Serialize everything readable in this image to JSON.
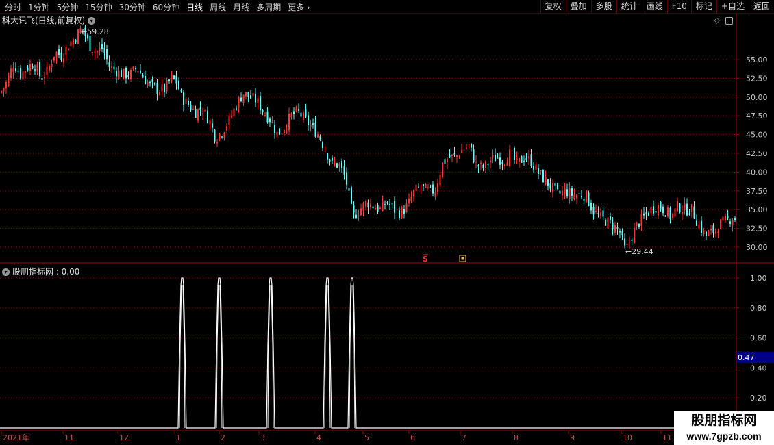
{
  "toolbar": {
    "periods": [
      "分时",
      "1分钟",
      "5分钟",
      "15分钟",
      "30分钟",
      "60分钟",
      "日线",
      "周线",
      "月线",
      "多周期",
      "更多"
    ],
    "active_index": 6,
    "right_buttons": [
      "复权",
      "叠加",
      "多股",
      "统计",
      "画线",
      "F10",
      "标记",
      "+自选",
      "返回"
    ]
  },
  "main_chart": {
    "title": "科大讯飞(日线,前复权)",
    "high_label": "59.28",
    "low_label": "29.44",
    "y_ticks": [
      "55.00",
      "52.50",
      "50.00",
      "47.50",
      "45.00",
      "42.50",
      "40.00",
      "37.50",
      "35.00",
      "32.50",
      "30.00"
    ],
    "y_values": [
      55,
      52.5,
      50,
      47.5,
      45,
      42.5,
      40,
      37.5,
      35,
      32.5,
      30
    ],
    "marker_s": "S",
    "up_color": "#ff3232",
    "down_color": "#54ffff"
  },
  "indicator": {
    "title": "股朋指标网 : 0.00",
    "y_ticks": [
      "1.00",
      "0.80",
      "0.60",
      "0.40",
      "0.20"
    ],
    "current_value": "0.47",
    "pulse_x": [
      266,
      320,
      395,
      478,
      514
    ]
  },
  "x_axis": {
    "labels": [
      "2021年",
      "11",
      "12",
      "1",
      "2",
      "3",
      "4",
      "5",
      "6",
      "7",
      "8",
      "9",
      "10",
      "11"
    ],
    "positions": [
      2,
      92,
      172,
      255,
      320,
      378,
      460,
      530,
      597,
      672,
      748,
      830,
      907,
      965
    ]
  },
  "chart_data": {
    "type": "candlestick",
    "title": "科大讯飞(日线,前复权)",
    "ylim": [
      28.5,
      62
    ],
    "close_path": [
      [
        0,
        50.5
      ],
      [
        10,
        52
      ],
      [
        20,
        54.5
      ],
      [
        30,
        53
      ],
      [
        40,
        54
      ],
      [
        50,
        54.5
      ],
      [
        60,
        52.5
      ],
      [
        70,
        53.5
      ],
      [
        80,
        56
      ],
      [
        90,
        55.5
      ],
      [
        100,
        57
      ],
      [
        110,
        58
      ],
      [
        120,
        59.28
      ],
      [
        130,
        57
      ],
      [
        140,
        56
      ],
      [
        150,
        56.5
      ],
      [
        160,
        54
      ],
      [
        170,
        53.5
      ],
      [
        180,
        53
      ],
      [
        190,
        53
      ],
      [
        200,
        54
      ],
      [
        210,
        52.5
      ],
      [
        220,
        51.5
      ],
      [
        230,
        51
      ],
      [
        240,
        51
      ],
      [
        250,
        52.5
      ],
      [
        258,
        52
      ],
      [
        265,
        50
      ],
      [
        275,
        49
      ],
      [
        285,
        48
      ],
      [
        295,
        48.5
      ],
      [
        305,
        47
      ],
      [
        315,
        44.5
      ],
      [
        325,
        45.5
      ],
      [
        335,
        47
      ],
      [
        345,
        49
      ],
      [
        355,
        50.5
      ],
      [
        365,
        50
      ],
      [
        375,
        49.5
      ],
      [
        385,
        48
      ],
      [
        395,
        47
      ],
      [
        405,
        45
      ],
      [
        415,
        46
      ],
      [
        425,
        47.5
      ],
      [
        435,
        48
      ],
      [
        445,
        47
      ],
      [
        455,
        46
      ],
      [
        465,
        45
      ],
      [
        475,
        43
      ],
      [
        485,
        41
      ],
      [
        495,
        41
      ],
      [
        505,
        39
      ],
      [
        515,
        34
      ],
      [
        525,
        35
      ],
      [
        535,
        36
      ],
      [
        545,
        35.5
      ],
      [
        555,
        35
      ],
      [
        565,
        36
      ],
      [
        575,
        35
      ],
      [
        585,
        34.5
      ],
      [
        595,
        35.5
      ],
      [
        605,
        37.5
      ],
      [
        615,
        38
      ],
      [
        625,
        37.5
      ],
      [
        635,
        37.5
      ],
      [
        645,
        41
      ],
      [
        655,
        42
      ],
      [
        665,
        42
      ],
      [
        675,
        43
      ],
      [
        685,
        43.5
      ],
      [
        695,
        41
      ],
      [
        705,
        40.5
      ],
      [
        715,
        41.5
      ],
      [
        725,
        42
      ],
      [
        735,
        41.5
      ],
      [
        745,
        42.5
      ],
      [
        755,
        41
      ],
      [
        765,
        42
      ],
      [
        775,
        41.5
      ],
      [
        785,
        40
      ],
      [
        795,
        39
      ],
      [
        805,
        38
      ],
      [
        815,
        37
      ],
      [
        825,
        37.5
      ],
      [
        835,
        37
      ],
      [
        845,
        37
      ],
      [
        855,
        37
      ],
      [
        865,
        35
      ],
      [
        875,
        34
      ],
      [
        885,
        33.5
      ],
      [
        895,
        33
      ],
      [
        905,
        32
      ],
      [
        913,
        29.44
      ],
      [
        920,
        31
      ],
      [
        930,
        33
      ],
      [
        940,
        34
      ],
      [
        950,
        35
      ],
      [
        960,
        35.5
      ],
      [
        970,
        35
      ],
      [
        980,
        34
      ],
      [
        990,
        35.5
      ],
      [
        1000,
        35
      ],
      [
        1010,
        35
      ],
      [
        1020,
        33
      ],
      [
        1030,
        31.5
      ],
      [
        1040,
        32
      ],
      [
        1050,
        33
      ],
      [
        1060,
        33.5
      ],
      [
        1070,
        34
      ],
      [
        1075,
        33.5
      ]
    ],
    "high": 59.28,
    "low": 29.44,
    "series": [
      {
        "values": [
          1,
          1,
          1,
          1,
          1
        ]
      }
    ]
  }
}
